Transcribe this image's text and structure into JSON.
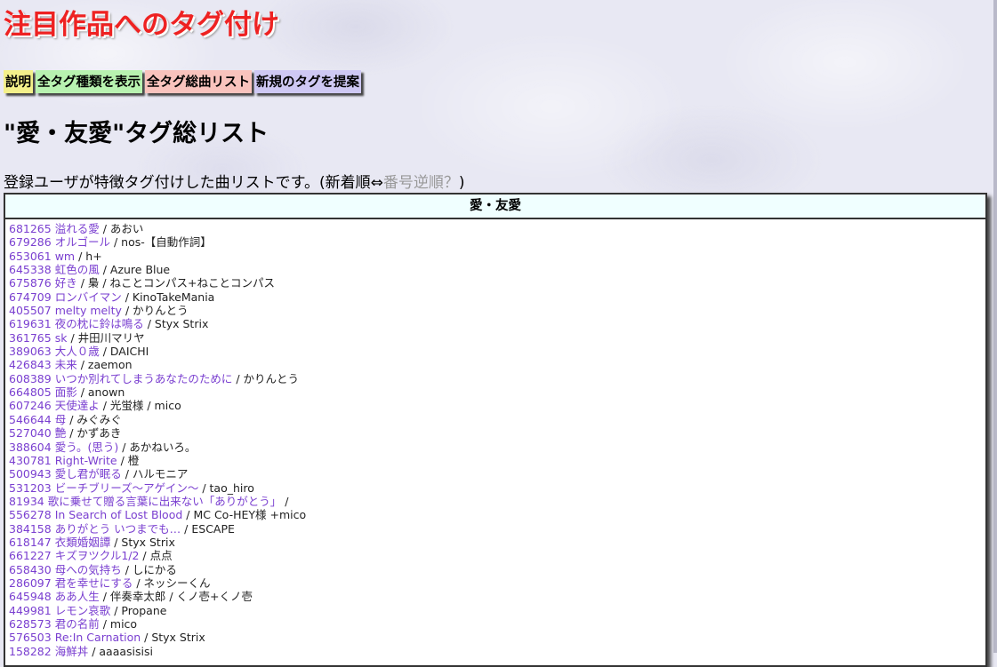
{
  "title": "注目作品へのタグ付け",
  "nav": [
    {
      "label": "説明",
      "color": "#f3f08a"
    },
    {
      "label": "全タグ種類を表示",
      "color": "#b8f2b0"
    },
    {
      "label": "全タグ総曲リスト",
      "color": "#f9c3bd"
    },
    {
      "label": "新規のタグを提案",
      "color": "#cec8f3"
    }
  ],
  "heading": "\"愛・友愛\"タグ総リスト",
  "description": {
    "text": "登録ユーザが特徴タグ付けした曲リストです。(新着順⇔",
    "link": "番号逆順？",
    "suffix": ")"
  },
  "table": {
    "header": "愛・友愛",
    "entries": [
      {
        "id": "681265",
        "title": "溢れる愛",
        "artist": "あおい"
      },
      {
        "id": "679286",
        "title": "オルゴール",
        "artist": "nos-【自動作詞】"
      },
      {
        "id": "653061",
        "title": "wm",
        "artist": "h+"
      },
      {
        "id": "645338",
        "title": "虹色の風",
        "artist": "Azure Blue"
      },
      {
        "id": "675876",
        "title": "好き",
        "artist": "梟 / ねことコンパス+ねことコンパス"
      },
      {
        "id": "674709",
        "title": "ロンバイマン",
        "artist": "KinoTakeMania"
      },
      {
        "id": "405507",
        "title": "melty melty",
        "artist": "かりんとう"
      },
      {
        "id": "619631",
        "title": "夜の枕に鈴は鳴る",
        "artist": "Styx Strix"
      },
      {
        "id": "361765",
        "title": "sk",
        "artist": "井田川マリヤ"
      },
      {
        "id": "389063",
        "title": "大人０歳",
        "artist": "DAICHI"
      },
      {
        "id": "426843",
        "title": "未来",
        "artist": "zaemon"
      },
      {
        "id": "608389",
        "title": "いつか別れてしまうあなたのために",
        "artist": "かりんとう"
      },
      {
        "id": "664805",
        "title": "面影",
        "artist": "anown"
      },
      {
        "id": "607246",
        "title": "天使達よ",
        "artist": "光蛍様 / mico"
      },
      {
        "id": "546644",
        "title": "母",
        "artist": "みぐみぐ"
      },
      {
        "id": "527040",
        "title": "艶",
        "artist": "かずあき"
      },
      {
        "id": "388604",
        "title": "愛う。(思う)",
        "artist": "あかねいろ。"
      },
      {
        "id": "430781",
        "title": "Right-Write",
        "artist": "橙"
      },
      {
        "id": "500943",
        "title": "愛し君が眠る",
        "artist": "ハルモニア"
      },
      {
        "id": "531203",
        "title": "ビーチブリーズ～アゲイン～",
        "artist": "tao_hiro"
      },
      {
        "id": "81934",
        "title": "歌に乗せて贈る言葉に出来ない「ありがとう」",
        "artist": ""
      },
      {
        "id": "556278",
        "title": "In Search of Lost Blood",
        "artist": "MC Co-HEY様 +mico"
      },
      {
        "id": "384158",
        "title": "ありがとう いつまでも…",
        "artist": "ESCAPE"
      },
      {
        "id": "618147",
        "title": "衣類婚姻譚",
        "artist": "Styx Strix"
      },
      {
        "id": "661227",
        "title": "キズヲツクル1/2",
        "artist": "点点"
      },
      {
        "id": "658430",
        "title": "母への気持ち",
        "artist": "しにかる"
      },
      {
        "id": "286097",
        "title": "君を幸せにする",
        "artist": "ネッシーくん"
      },
      {
        "id": "645948",
        "title": "ああ人生",
        "artist": "伴奏幸太郎 / くノ壱+くノ壱"
      },
      {
        "id": "449981",
        "title": "レモン哀歌",
        "artist": "Propane"
      },
      {
        "id": "628573",
        "title": "君の名前",
        "artist": "mico"
      },
      {
        "id": "576503",
        "title": "Re:In Carnation",
        "artist": "Styx Strix"
      },
      {
        "id": "158282",
        "title": "海鮮丼",
        "artist": "aaaasisisi"
      }
    ]
  }
}
